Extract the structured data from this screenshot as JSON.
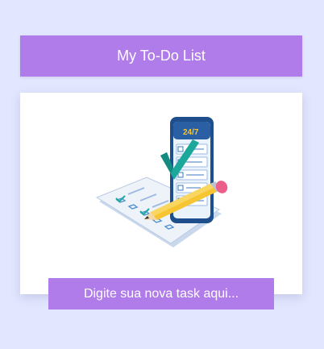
{
  "header": {
    "title": "My To-Do List"
  },
  "illustration": {
    "icon": "checklist-phone-illustration",
    "phone_badge": "24/7"
  },
  "task_input": {
    "placeholder": "Digite sua nova task aqui...",
    "value": ""
  },
  "colors": {
    "page_background": "#e2e6fe",
    "accent": "#b07ce9",
    "card_background": "#ffffff",
    "check_teal": "#1ba89a",
    "phone_blue": "#1f4e8c",
    "pencil_yellow": "#f7c531",
    "eraser_pink": "#ec5f8a"
  }
}
